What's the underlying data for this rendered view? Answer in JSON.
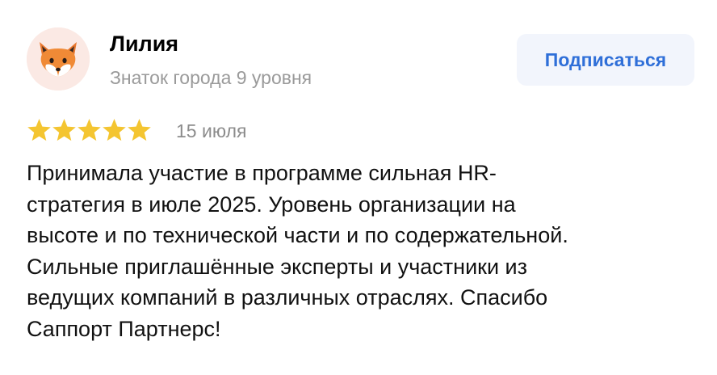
{
  "author": {
    "name": "Лилия",
    "level": "Знаток города 9 уровня",
    "avatar_icon": "fox-avatar-icon"
  },
  "subscribe_label": "Подписаться",
  "rating": {
    "stars": 5,
    "max": 5,
    "star_color": "#f4c531"
  },
  "date": "15 июля",
  "text_lines": [
    "Принимала участие в программе сильная HR-",
    "стратегия в июле 2025. Уровень организации на",
    "высоте и по технической части и по содержательной.",
    "Сильные приглашённые эксперты и участники из",
    "ведущих компаний в различных отраслях. Спасибо",
    "Саппорт Партнерс!"
  ],
  "colors": {
    "accent": "#2f6fd8",
    "button_bg": "#f2f5fc",
    "muted_text": "#9a9a9a",
    "avatar_bg": "#fbe9e4"
  }
}
